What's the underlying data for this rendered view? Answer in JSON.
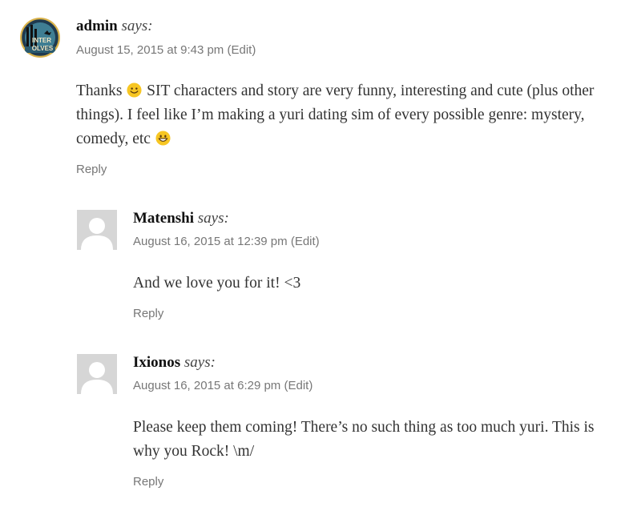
{
  "comments": [
    {
      "author": "admin",
      "says": "says:",
      "date": "August 15, 2015 at 9:43 pm",
      "edit": "(Edit)",
      "text_1": "Thanks",
      "text_2": "SIT characters and story are very funny, interesting and cute (plus other things). I feel like I’m making a yuri dating sim of every possible genre: mystery, comedy, etc",
      "reply": "Reply",
      "avatar_logo": [
        "INTER",
        "OLVES"
      ],
      "emoji_1": "slight-smile-icon",
      "emoji_2": "grin-icon"
    },
    {
      "author": "Matenshi",
      "says": "says:",
      "date": "August 16, 2015 at 12:39 pm",
      "edit": "(Edit)",
      "text": "And we love you for it! <3",
      "reply": "Reply"
    },
    {
      "author": "Ixionos",
      "says": "says:",
      "date": "August 16, 2015 at 6:29 pm",
      "edit": "(Edit)",
      "text": "Please keep them coming! There’s no such thing as too much yuri. This is why you Rock! \\m/",
      "reply": "Reply"
    }
  ],
  "colors": {
    "text": "#333333",
    "meta": "#777777",
    "avatar_bg": "#d6d6d6",
    "logo_bg": "#1f3a4f",
    "logo_ring": "#d9b24a",
    "emoji": "#f7c623"
  }
}
